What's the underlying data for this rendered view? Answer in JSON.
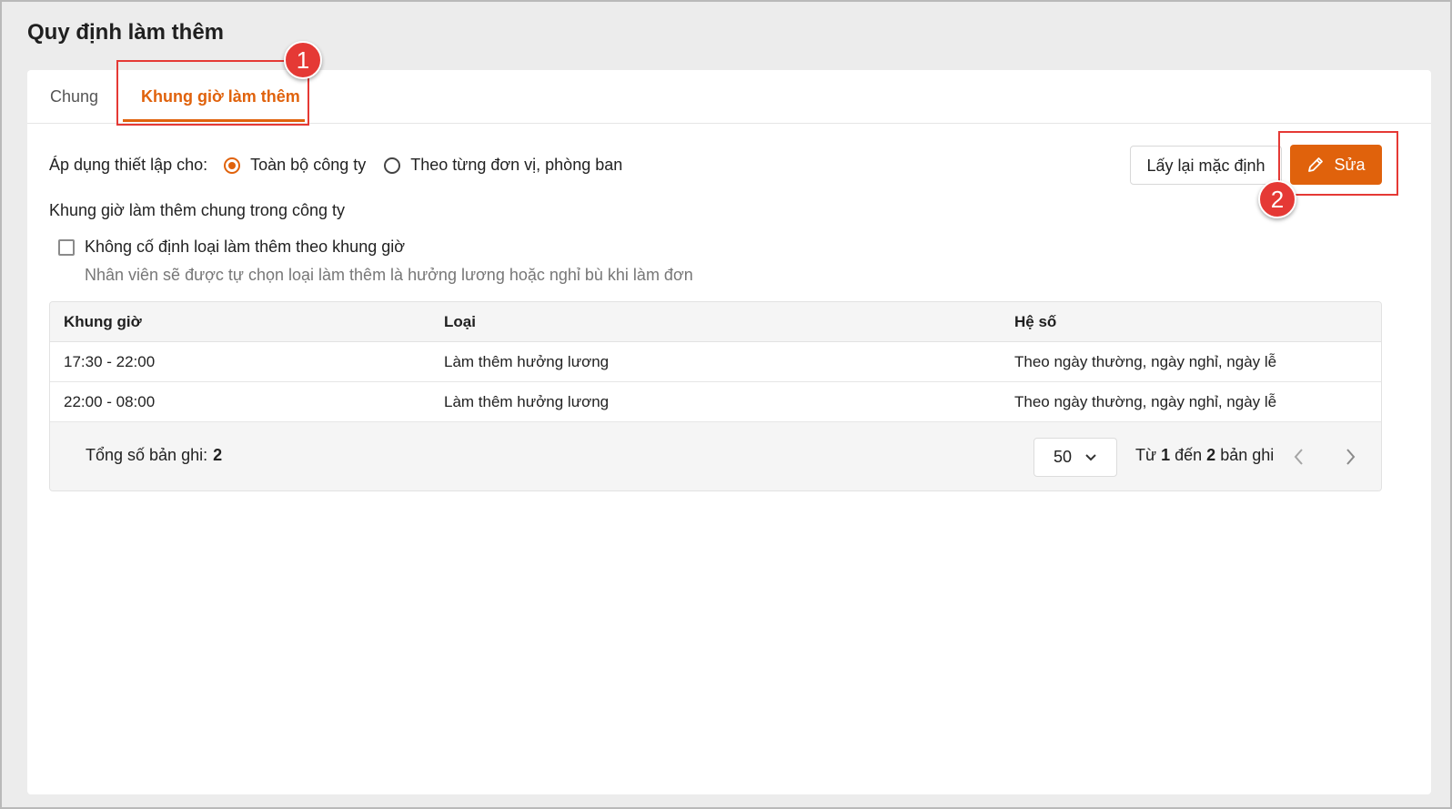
{
  "page": {
    "title": "Quy định làm thêm"
  },
  "tabs": [
    {
      "label": "Chung"
    },
    {
      "label": "Khung giờ làm thêm"
    }
  ],
  "apply": {
    "label": "Áp dụng thiết lập cho:",
    "options": [
      {
        "label": "Toàn bộ công ty",
        "selected": true
      },
      {
        "label": "Theo từng đơn vị, phòng ban",
        "selected": false
      }
    ]
  },
  "actions": {
    "reset_label": "Lấy lại mặc định",
    "edit_label": "Sửa",
    "edit_icon": "pencil-icon"
  },
  "section": {
    "title": "Khung giờ làm thêm chung trong công ty",
    "checkbox_label": "Không cố định loại làm thêm theo khung giờ",
    "checkbox_checked": false,
    "checkbox_description": "Nhân viên sẽ được tự chọn loại làm thêm là hưởng lương hoặc nghỉ bù khi làm đơn"
  },
  "table": {
    "headers": [
      "Khung giờ",
      "Loại",
      "Hệ số"
    ],
    "rows": [
      [
        "17:30 - 22:00",
        "Làm thêm hưởng lương",
        "Theo ngày thường, ngày nghỉ, ngày lễ"
      ],
      [
        "22:00 - 08:00",
        "Làm thêm hưởng lương",
        "Theo ngày thường, ngày nghỉ, ngày lễ"
      ]
    ]
  },
  "footer": {
    "total_label": "Tổng số bản ghi:",
    "total_value": "2",
    "page_size": "50",
    "range_prefix": "Từ",
    "range_from": "1",
    "range_mid": "đến",
    "range_to": "2",
    "range_suffix": "bản ghi"
  },
  "annotations": [
    {
      "number": "1"
    },
    {
      "number": "2"
    }
  ],
  "colors": {
    "accent": "#e0620c",
    "annotation": "#e53935",
    "background": "#ececec"
  }
}
